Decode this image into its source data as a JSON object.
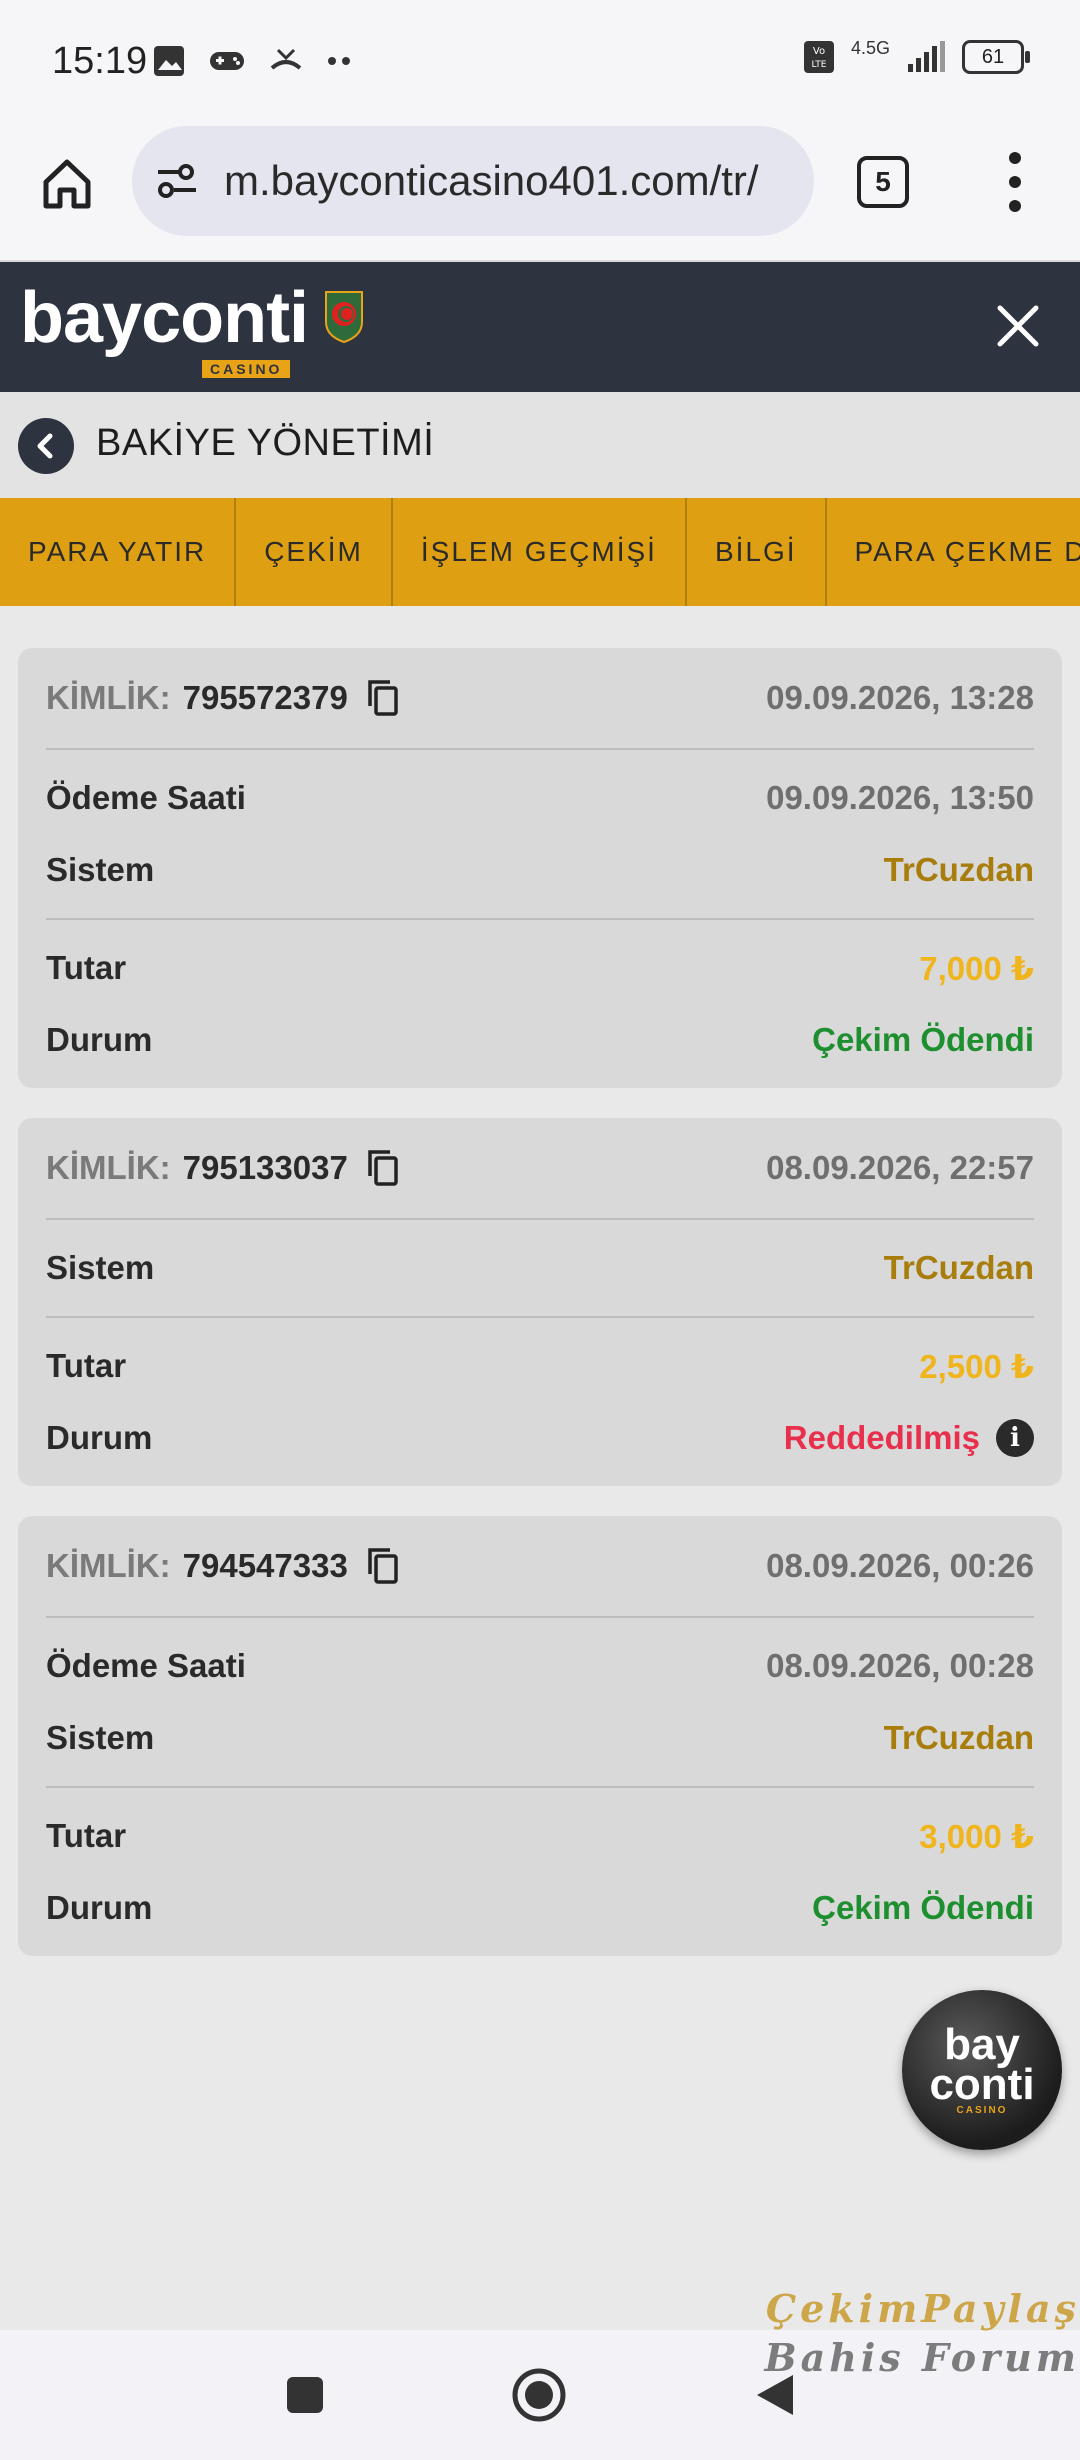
{
  "status_bar": {
    "time": "15:19",
    "network": "4.5G",
    "battery": "61"
  },
  "browser": {
    "url": "m.bayconticasino401.com/tr/",
    "tab_count": "5"
  },
  "site": {
    "logo_text": "bayconti",
    "logo_sub": "CASINO"
  },
  "page": {
    "title": "BAKİYE YÖNETİMİ"
  },
  "tabs": [
    "PARA YATIR",
    "ÇEKİM",
    "İŞLEM GEÇMİŞİ",
    "BİLGİ",
    "PARA ÇEKME DURUMU"
  ],
  "labels": {
    "id": "KİMLİK:",
    "payment_time": "Ödeme Saati",
    "system": "Sistem",
    "amount": "Tutar",
    "status": "Durum"
  },
  "transactions": [
    {
      "id": "795572379",
      "date": "09.09.2026, 13:28",
      "payment_time": "09.09.2026, 13:50",
      "system": "TrCuzdan",
      "amount": "7,000 ₺",
      "status": "Çekim Ödendi"
    },
    {
      "id": "795133037",
      "date": "08.09.2026, 22:57",
      "system": "TrCuzdan",
      "amount": "2,500 ₺",
      "status": "Reddedilmiş"
    },
    {
      "id": "794547333",
      "date": "08.09.2026, 00:26",
      "payment_time": "08.09.2026, 00:28",
      "system": "TrCuzdan",
      "amount": "3,000 ₺",
      "status": "Çekim Ödendi"
    }
  ],
  "float_logo": {
    "line1": "bay",
    "line2": "conti",
    "sub": "CASINO"
  },
  "watermark": {
    "line1": "ÇekimPaylaş",
    "line2": "Bahis Forum"
  },
  "colors": {
    "header": "#2e3340",
    "tab_bar": "#dea012",
    "paid": "#1d8f2f",
    "rejected": "#e8304d",
    "amount": "#f0b51c",
    "system": "#a87d0b"
  }
}
